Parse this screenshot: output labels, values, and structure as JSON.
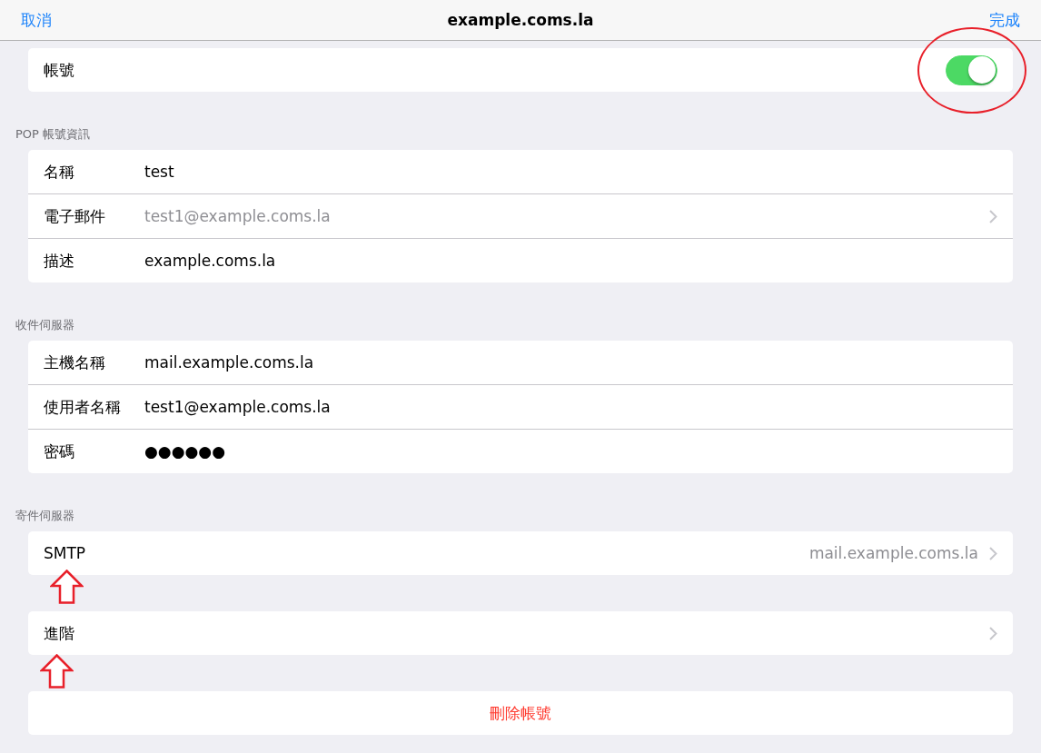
{
  "nav": {
    "cancel": "取消",
    "title": "example.coms.la",
    "done": "完成"
  },
  "groups": [
    {
      "rows": [
        {
          "kind": "toggle",
          "label": "帳號",
          "on": true,
          "circled": true
        }
      ]
    },
    {
      "header": "POP 帳號資訊",
      "rows": [
        {
          "kind": "field",
          "label": "名稱",
          "value": "test",
          "dimmed": false,
          "chevron": false
        },
        {
          "kind": "field",
          "label": "電子郵件",
          "value": "test1@example.coms.la",
          "dimmed": true,
          "chevron": true
        },
        {
          "kind": "field",
          "label": "描述",
          "value": "example.coms.la",
          "dimmed": false,
          "chevron": false
        }
      ]
    },
    {
      "header": "收件伺服器",
      "rows": [
        {
          "kind": "field",
          "label": "主機名稱",
          "value": "mail.example.coms.la",
          "dimmed": false,
          "chevron": false
        },
        {
          "kind": "field",
          "label": "使用者名稱",
          "value": "test1@example.coms.la",
          "dimmed": false,
          "chevron": false
        },
        {
          "kind": "field",
          "label": "密碼",
          "value": "●●●●●●",
          "dimmed": false,
          "chevron": false
        }
      ]
    },
    {
      "header": "寄件伺服器",
      "rows": [
        {
          "kind": "detail",
          "label": "SMTP",
          "value": "mail.example.coms.la",
          "chevron": true,
          "arrow_marked": true
        }
      ]
    },
    {
      "rows": [
        {
          "kind": "detail",
          "label": "進階",
          "chevron": true,
          "arrow_marked": true
        }
      ]
    },
    {
      "rows": [
        {
          "kind": "action",
          "label": "刪除帳號"
        }
      ]
    }
  ]
}
